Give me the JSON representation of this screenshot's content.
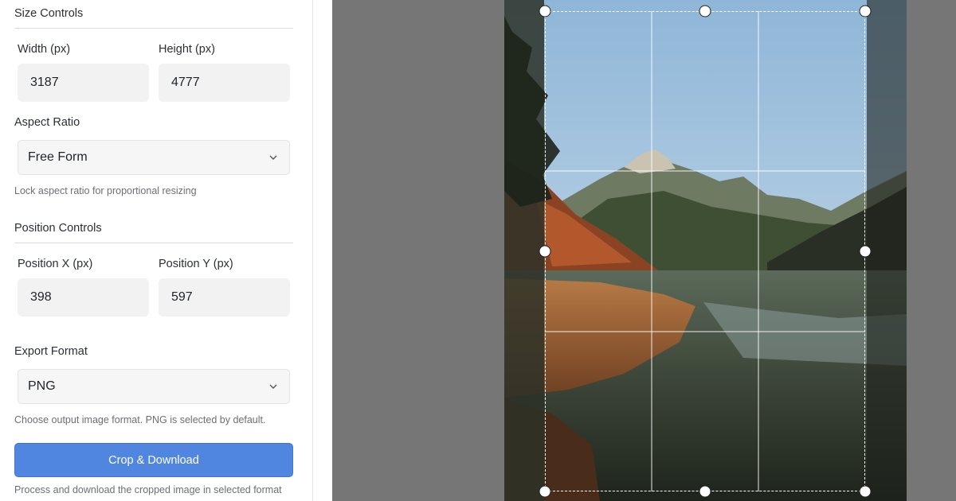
{
  "size_controls": {
    "title": "Size Controls",
    "width_label": "Width (px)",
    "width_value": "3187",
    "height_label": "Height (px)",
    "height_value": "4777"
  },
  "aspect_ratio": {
    "label": "Aspect Ratio",
    "selected": "Free Form",
    "help": "Lock aspect ratio for proportional resizing"
  },
  "position_controls": {
    "title": "Position Controls",
    "x_label": "Position X (px)",
    "x_value": "398",
    "y_label": "Position Y (px)",
    "y_value": "597"
  },
  "export": {
    "label": "Export Format",
    "selected": "PNG",
    "help": "Choose output image format. PNG is selected by default.",
    "button": "Crop & Download",
    "button_help": "Process and download the cropped image in selected format"
  },
  "icons": {
    "select_chevron": "chevron-down-icon"
  },
  "colors": {
    "accent": "#5186e0",
    "canvas_bg": "#767676",
    "input_bg": "#f2f2f2"
  }
}
